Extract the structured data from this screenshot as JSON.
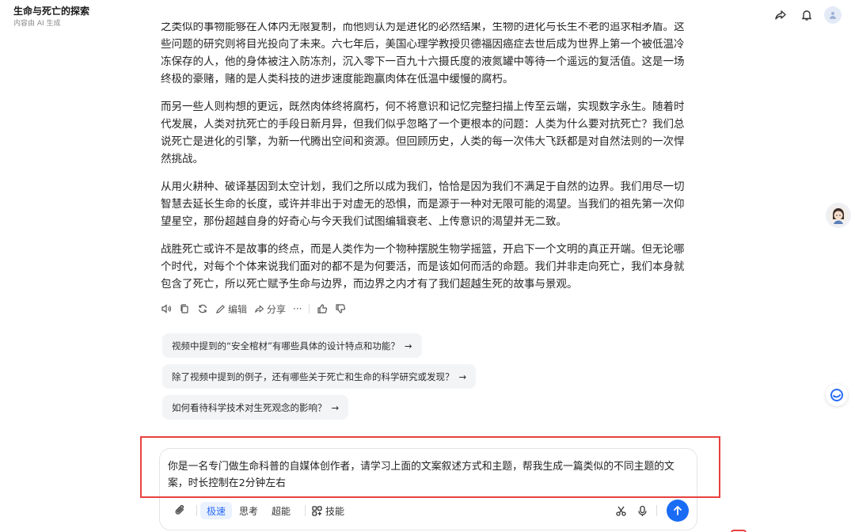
{
  "header": {
    "title": "生命与死亡的探索",
    "subtitle": "内容由 AI 生成"
  },
  "article": {
    "p0_partial": "之类似的事物能够在人体内无限复制，而他则认为是进化的必然结果，生物的进化与长生不老的追求相矛盾。这些问题的研究则将目光投向了未来。六七年后，美国心理学教授贝德福因癌症去世后成为世界上第一个被低温冷冻保存的人，他的身体被注入防冻剂，沉入零下一百九十六摄氏度的液氮罐中等待一个遥远的复活值。这是一场终极的豪赌，赌的是人类科技的进步速度能跑赢肉体在低温中缓慢的腐朽。",
    "p1": "而另一些人则构想的更远，既然肉体终将腐朽，何不将意识和记忆完整扫描上传至云端，实现数字永生。随着时代发展，人类对抗死亡的手段日新月异，但我们似乎忽略了一个更根本的问题：人类为什么要对抗死亡？我们总说死亡是进化的引擎，为新一代腾出空间和资源。但回顾历史，人类的每一次伟大飞跃都是对自然法则的一次悍然挑战。",
    "p2": "从用火耕种、破译基因到太空计划，我们之所以成为我们，恰恰是因为我们不满足于自然的边界。我们用尽一切智慧去延长生命的长度，或许并非出于对虚无的恐惧，而是源于一种对无限可能的渴望。当我们的祖先第一次仰望星空，那份超越自身的好奇心与今天我们试图编辑衰老、上传意识的渴望并无二致。",
    "p3": "战胜死亡或许不是故事的终点，而是人类作为一个物种摆脱生物学摇篮，开启下一个文明的真正开端。但无论哪个时代，对每个个体来说我们面对的都不是为何要活，而是该如何而活的命题。我们并非走向死亡，我们本身就包含了死亡，所以死亡赋予生命与边界，而边界之内才有了我们超越生死的故事与景观。"
  },
  "actions": {
    "edit_label": "编辑",
    "share_label": "分享",
    "more_label": "···"
  },
  "suggestions": [
    {
      "text": "视频中提到的“安全棺材”有哪些具体的设计特点和功能？",
      "arrow": "→"
    },
    {
      "text": "除了视频中提到的例子，还有哪些关于死亡和生命的科学研究或发现？",
      "arrow": "→"
    },
    {
      "text": "如何看待科学技术对生死观念的影响？",
      "arrow": "→"
    }
  ],
  "input": {
    "value": "你是一名专门做生命科普的自媒体创作者，请学习上面的文案叙述方式和主题，帮我生成一篇类似的不同主题的文案，时长控制在2分钟左右"
  },
  "toolbar": {
    "mode_fast": "极速",
    "mode_think": "思考",
    "mode_super": "超能",
    "skills": "技能"
  },
  "colors": {
    "accent": "#1a6cf5",
    "highlight_border": "#e8413e",
    "suggestion_bg": "#f3f4f6"
  }
}
